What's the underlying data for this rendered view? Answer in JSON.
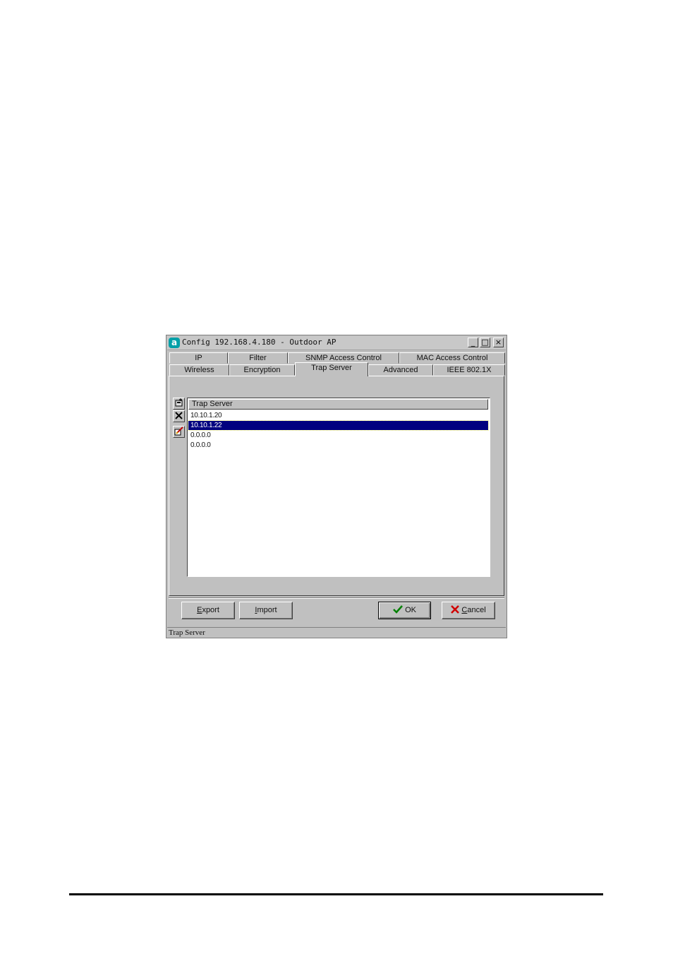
{
  "window": {
    "app_icon_glyph": "a",
    "title": "Config 192.168.4.180 - Outdoor AP",
    "controls": {
      "minimize": "_",
      "maximize": "□",
      "close": "×"
    }
  },
  "tabs": {
    "row_top": [
      "IP",
      "Filter",
      "SNMP Access Control",
      "MAC Access Control"
    ],
    "row_bottom": [
      "Wireless",
      "Encryption",
      "Trap Server",
      "Advanced",
      "IEEE 802.1X"
    ],
    "active": "Trap Server"
  },
  "toolbar": {
    "add_icon": "add-server-icon",
    "delete_icon": "delete-icon",
    "edit_icon": "edit-icon"
  },
  "list": {
    "header": "Trap Server",
    "rows": [
      "10.10.1.20",
      "10.10.1.22",
      "0.0.0.0",
      "0.0.0.0"
    ],
    "selected_index": 1
  },
  "buttons": {
    "export_first": "E",
    "export_rest": "xport",
    "import_first": "I",
    "import_rest": "mport",
    "ok_label": "OK",
    "cancel_first": "C",
    "cancel_rest": "ancel"
  },
  "statusbar": {
    "text": "Trap Server"
  },
  "colors": {
    "selection": "#000080",
    "ok_check": "#008000",
    "cancel_x": "#d00000"
  }
}
